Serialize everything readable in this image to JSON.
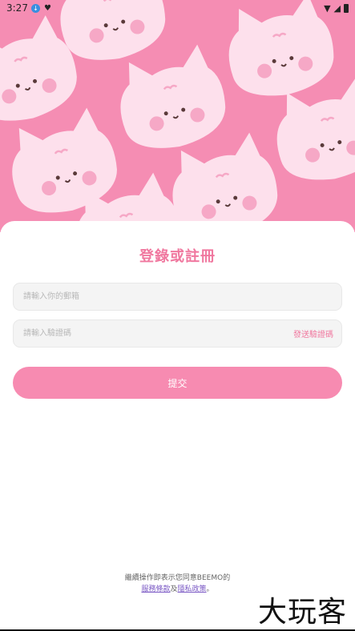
{
  "status_bar": {
    "time": "3:27"
  },
  "hero": {
    "accent_color": "#f58db3",
    "cat_color": "#fde0ec"
  },
  "login": {
    "title": "登錄或註冊",
    "email_placeholder": "請輸入你的郵箱",
    "code_placeholder": "請輸入驗證碼",
    "send_code_label": "發送驗證碼",
    "submit_label": "提交",
    "accent_color": "#f78bb1"
  },
  "footer": {
    "line1": "繼續操作即表示您同意BEEMO的",
    "terms_label": "服務條款",
    "and_text": "及",
    "privacy_label": "隱私政策",
    "end_text": "。"
  },
  "watermark": {
    "text": "大玩客"
  }
}
